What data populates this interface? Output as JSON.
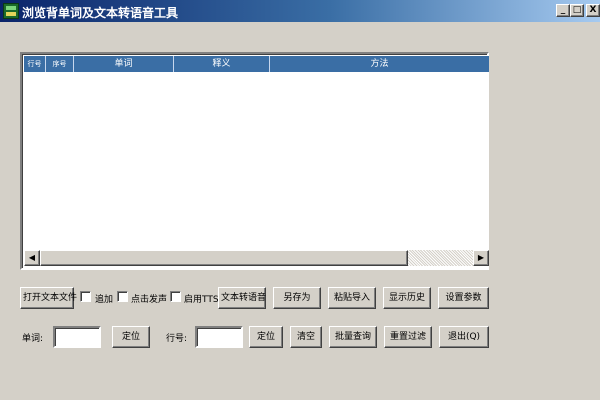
{
  "window": {
    "title": "浏览背单词及文本转语音工具",
    "icons": {
      "app": "app-icon",
      "minimize": "minimize-icon",
      "maximize": "maximize-icon",
      "close": "close-icon"
    },
    "controls": {
      "minimize": "_",
      "maximize": "□",
      "close": "X"
    }
  },
  "list": {
    "columns": [
      "行号",
      "序号",
      "单词",
      "释义",
      "方法"
    ],
    "rows": [],
    "scroll_arrows": {
      "left": "◀",
      "right": "▶"
    }
  },
  "toolbar": {
    "open_file": "打开文本文件",
    "append_label": "追加",
    "click_speak_label": "点击发声",
    "enable_tts_label": "启用TTS",
    "text_to_speech": "文本转语音",
    "save_as": "另存为",
    "paste_import": "粘贴导入",
    "show_history": "显示历史",
    "settings": "设置参数"
  },
  "search": {
    "word_label": "单词:",
    "word_value": "",
    "locate_word": "定位",
    "line_label": "行号:",
    "line_value": "",
    "locate_line": "定位",
    "clear": "清空",
    "batch_query": "批量查询",
    "reset_filter": "重置过滤",
    "exit": "退出(Q)"
  },
  "colors": {
    "face": "#d4d0c8",
    "header": "#3a6ea5",
    "title_start": "#0a246a",
    "title_end": "#a6caf0"
  }
}
